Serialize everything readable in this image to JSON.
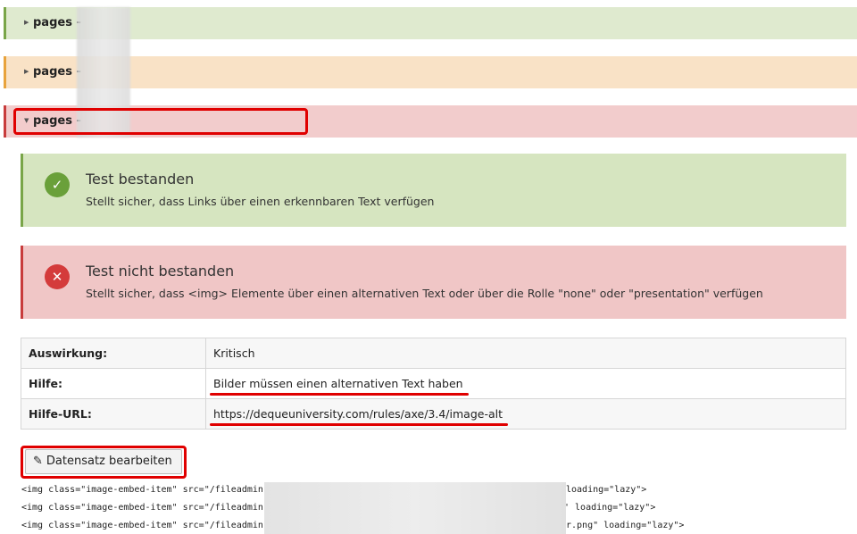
{
  "panels": [
    {
      "title": "pages -",
      "state": "collapsed",
      "status": "green"
    },
    {
      "title": "pages -",
      "state": "collapsed",
      "status": "orange"
    },
    {
      "title": "pages -",
      "state": "expanded",
      "status": "red"
    }
  ],
  "results": {
    "passed": {
      "icon": "check-circle-icon",
      "title": "Test bestanden",
      "description": "Stellt sicher, dass Links über einen erkennbaren Text verfügen"
    },
    "failed": {
      "icon": "x-circle-icon",
      "title": "Test nicht bestanden",
      "description": "Stellt sicher, dass <img> Elemente über einen alternativen Text oder über die Rolle \"none\" oder \"presentation\" verfügen"
    }
  },
  "details": {
    "impact_label": "Auswirkung:",
    "impact_value": "Kritisch",
    "help_label": "Hilfe:",
    "help_value": "Bilder müssen einen alternativen Text haben",
    "help_url_label": "Hilfe-URL:",
    "help_url_value": "https://dequeuniversity.com/rules/axe/3.4/image-alt"
  },
  "edit_button": {
    "label": "Datensatz bearbeiten",
    "icon": "pencil-icon"
  },
  "code_lines": [
    {
      "start": "<img class=\"image-embed-item\" src=\"/fileadmin,",
      "end": "loading=\"lazy\">"
    },
    {
      "start": "<img class=\"image-embed-item\" src=\"/fileadmin,",
      "end": "' loading=\"lazy\">"
    },
    {
      "start": "<img class=\"image-embed-item\" src=\"/fileadmin,",
      "end": "r.png\" loading=\"lazy\">"
    }
  ],
  "colors": {
    "success": "#79a548",
    "warning": "#e8a33d",
    "danger": "#c83c3c",
    "annotation": "#e00000"
  }
}
